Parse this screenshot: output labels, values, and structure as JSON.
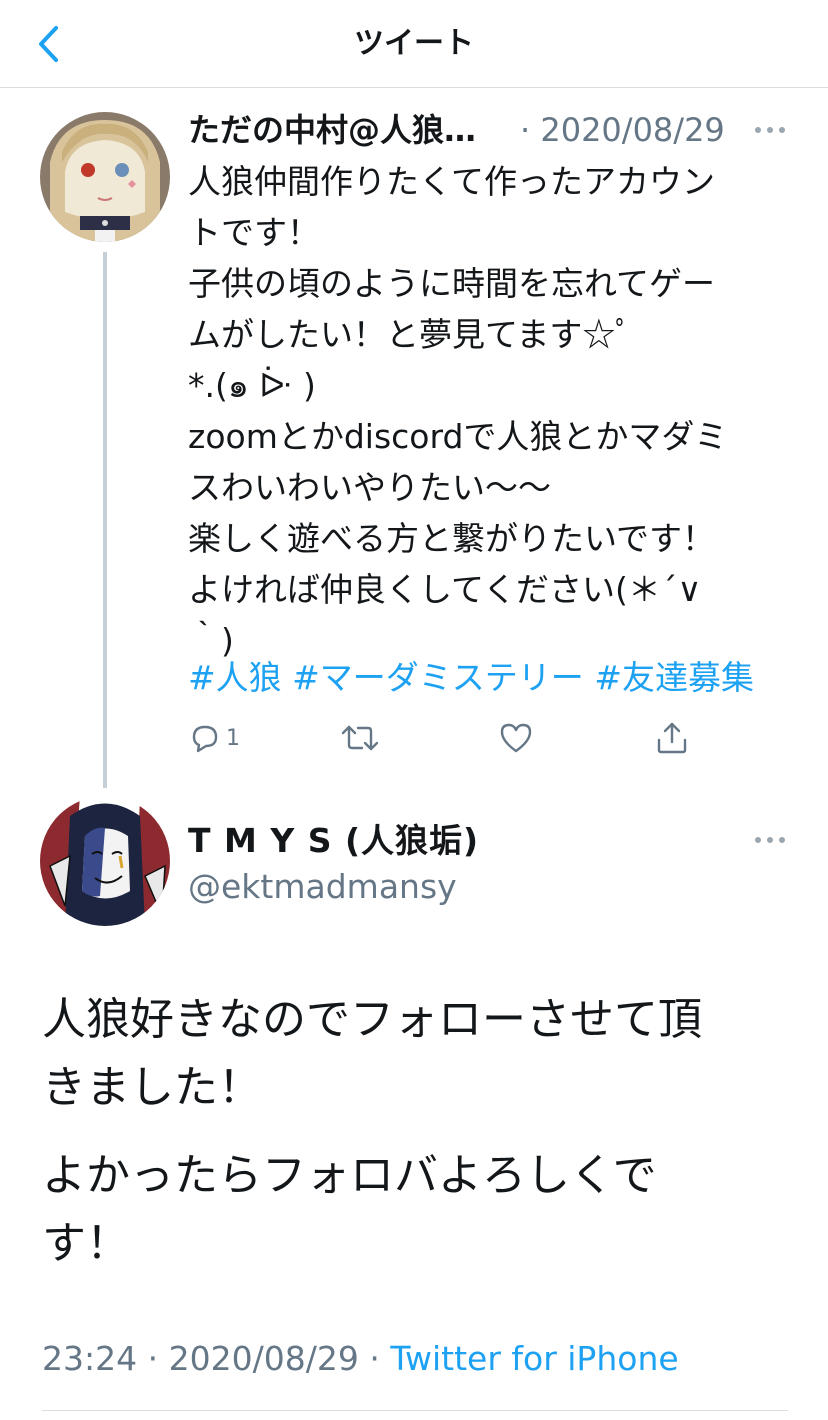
{
  "header": {
    "back_icon": "chevron-left-icon",
    "title": "ツイート"
  },
  "colors": {
    "accent": "#1da1f2",
    "secondary_text": "#657786",
    "thread_line": "#c4cfd6",
    "divider": "#d9dde1"
  },
  "tweet1": {
    "name": "ただの中村@人狼…",
    "date": "· 2020/08/29",
    "more_icon": "more-dots-icon",
    "body_lines": [
      "人狼仲間作りたくて作ったアカウン",
      "トです！",
      "子供の頃のように時間を忘れてゲー",
      "ムがしたい！と夢見てます☆ﾟ",
      "*.(๑ ᐕ )",
      "zoomとかdiscordで人狼とかマダミ",
      "スわいわいやりたい〜〜",
      "楽しく遊べる方と繋がりたいです！",
      "よければ仲良くしてください(＊´∨",
      "｀)"
    ],
    "hashtags": [
      "#人狼",
      "#マーダミステリー",
      "#友達募集"
    ],
    "actions": {
      "reply_icon": "reply-icon",
      "reply_count": "1",
      "retweet_icon": "retweet-icon",
      "like_icon": "heart-icon",
      "share_icon": "share-icon"
    }
  },
  "tweet2": {
    "name": "T M Y S (人狼垢)",
    "handle": "@ektmadmansy",
    "more_icon": "more-dots-icon",
    "paragraph1": [
      "人狼好きなのでフォローさせて頂",
      "きました！"
    ],
    "paragraph2": [
      "よかったらフォロバよろしくで",
      "す！"
    ],
    "time": "23:24",
    "separator": "·",
    "date": "2020/08/29",
    "source": "Twitter for iPhone"
  }
}
